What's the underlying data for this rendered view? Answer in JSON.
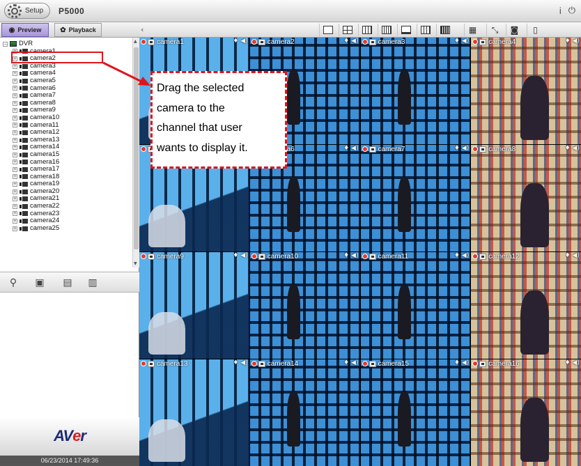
{
  "app": {
    "setup_label": "Setup",
    "title": "P5000"
  },
  "modes": {
    "preview_label": "Preview",
    "playback_label": "Playback"
  },
  "toolbar": {
    "icons": [
      "single-layout-icon",
      "quad-layout-icon",
      "nine-layout-icon",
      "sixteen-layout-icon",
      "pip-layout-icon",
      "layout-13-icon",
      "full-grid-icon",
      "sequence-icon",
      "fullscreen-icon",
      "snapshot-icon",
      "recycle-icon"
    ]
  },
  "tree": {
    "root": "DVR",
    "cameras": [
      "camera1",
      "camera2",
      "camera3",
      "camera4",
      "camera5",
      "camera6",
      "camera7",
      "camera8",
      "camera9",
      "camera10",
      "camera11",
      "camera12",
      "camera13",
      "camera14",
      "camera15",
      "camera16",
      "camera17",
      "camera18",
      "camera19",
      "camera20",
      "camera21",
      "camera22",
      "camera23",
      "camera24",
      "camera25"
    ],
    "selected": "camera1"
  },
  "tiles": [
    {
      "name": "camera1",
      "scene": "a"
    },
    {
      "name": "camera2",
      "scene": "b"
    },
    {
      "name": "camera3",
      "scene": "b"
    },
    {
      "name": "camera4",
      "scene": "c"
    },
    {
      "name": "camera5",
      "scene": "a"
    },
    {
      "name": "camera6",
      "scene": "b"
    },
    {
      "name": "camera7",
      "scene": "b"
    },
    {
      "name": "camera8",
      "scene": "c"
    },
    {
      "name": "camera9",
      "scene": "a"
    },
    {
      "name": "camera10",
      "scene": "b"
    },
    {
      "name": "camera11",
      "scene": "b"
    },
    {
      "name": "camera12",
      "scene": "c"
    },
    {
      "name": "camera13",
      "scene": "a"
    },
    {
      "name": "camera14",
      "scene": "b"
    },
    {
      "name": "camera15",
      "scene": "b"
    },
    {
      "name": "camera16",
      "scene": "c"
    }
  ],
  "annotation": {
    "lines": [
      "Drag the selected",
      "camera to the",
      "channel that user",
      "wants to display it."
    ]
  },
  "brand": {
    "logo_prefix": "AV",
    "logo_accent": "e",
    "logo_suffix": "r"
  },
  "status": {
    "datetime": "06/23/2014 17:49:36"
  },
  "colors": {
    "highlight": "#e0141b",
    "preview_tab": "#a796d8",
    "logo_blue": "#1d2b7a"
  }
}
